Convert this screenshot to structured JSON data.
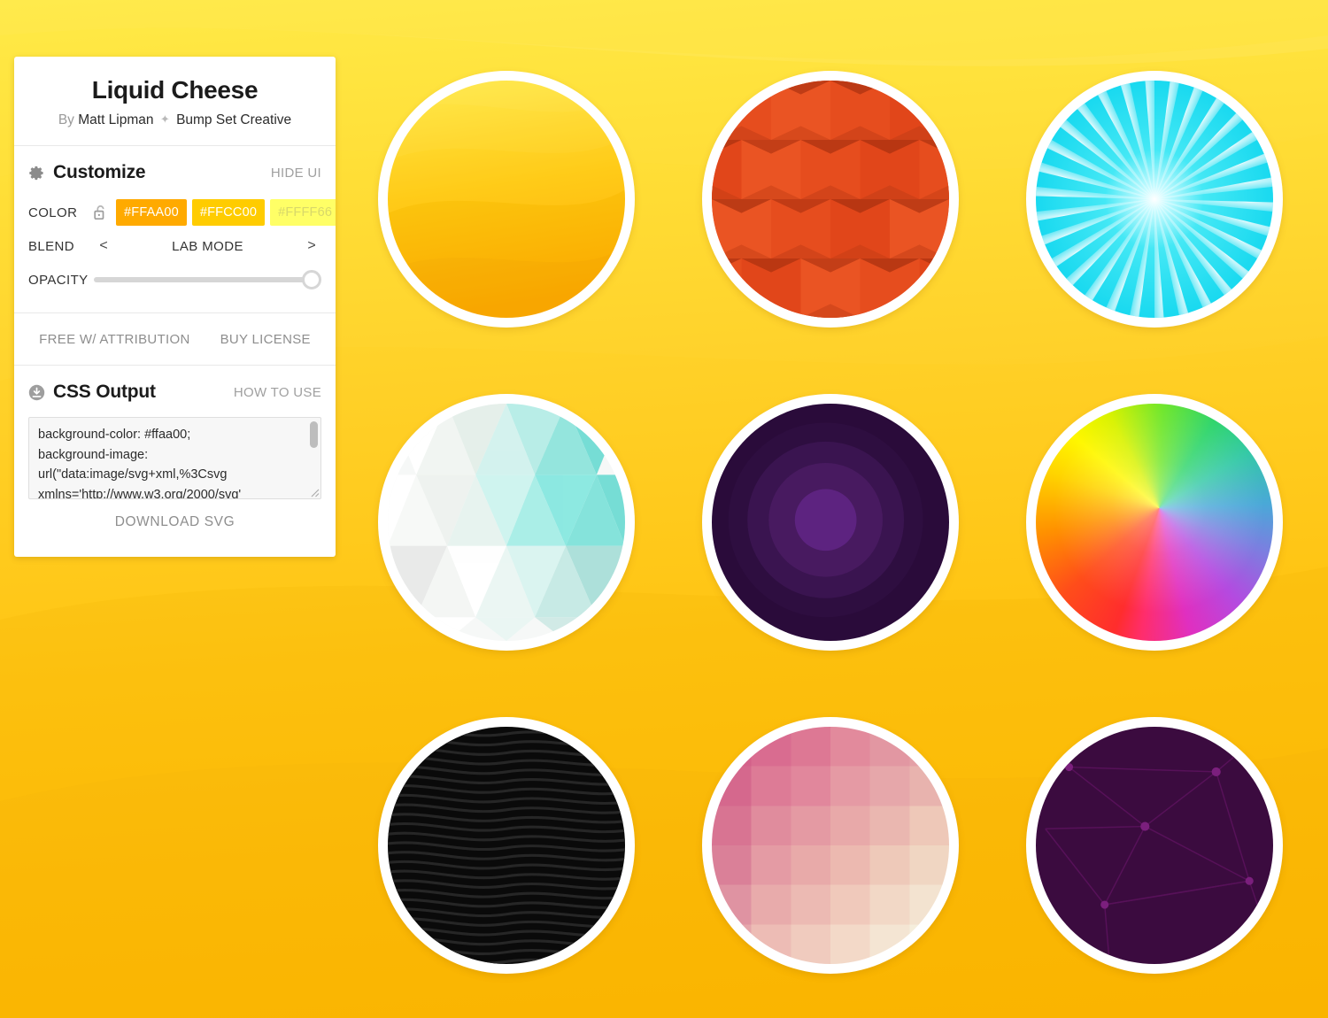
{
  "app": {
    "title": "Liquid Cheese",
    "byline_by": "By",
    "byline_author": "Matt Lipman",
    "byline_sparkle": "✦",
    "byline_studio": "Bump Set Creative"
  },
  "customize": {
    "title": "Customize",
    "gear_icon": "gear-icon",
    "hide_ui_label": "HIDE UI",
    "color": {
      "label": "COLOR",
      "lock_icon": "unlocked-padlock-icon",
      "swatches": [
        {
          "hex": "#FFAA00",
          "text_color": "#ffffff"
        },
        {
          "hex": "#FFCC00",
          "text_color": "#ffffff"
        },
        {
          "hex": "#FFFF66",
          "text_color": "#d8d86a"
        }
      ]
    },
    "blend": {
      "label": "BLEND",
      "prev_arrow": "<",
      "mode": "LAB MODE",
      "next_arrow": ">"
    },
    "opacity": {
      "label": "OPACITY",
      "value": 100
    }
  },
  "license": {
    "free_label": "FREE W/ ATTRIBUTION",
    "buy_label": "BUY LICENSE"
  },
  "css_output": {
    "title": "CSS Output",
    "download_icon": "download-circle-icon",
    "how_to_use_label": "HOW TO USE",
    "code": "background-color: #ffaa00;\nbackground-image: url(\"data:image/svg+xml,%3Csvg xmlns='http://www.w3.org/2000/svg'",
    "download_svg_label": "DOWNLOAD SVG"
  },
  "background": {
    "base_top": "#FFE93F",
    "base_bottom": "#FFBA00"
  },
  "thumbnails": [
    {
      "name": "thumb-liquid-cheese",
      "pattern": "waves-yellow"
    },
    {
      "name": "thumb-rectangle-wall",
      "pattern": "folded-rectangles-orange"
    },
    {
      "name": "thumb-sun-rays",
      "pattern": "sunburst-cyan"
    },
    {
      "name": "thumb-low-poly-grid",
      "pattern": "triangle-mosaic-mint"
    },
    {
      "name": "thumb-radial-rings",
      "pattern": "concentric-purple"
    },
    {
      "name": "thumb-color-wheel",
      "pattern": "conic-rainbow"
    },
    {
      "name": "thumb-wavy-lines",
      "pattern": "wavy-stripes-black"
    },
    {
      "name": "thumb-pixel-grid",
      "pattern": "checker-pink-cream"
    },
    {
      "name": "thumb-constellation",
      "pattern": "network-nodes-purple"
    }
  ]
}
